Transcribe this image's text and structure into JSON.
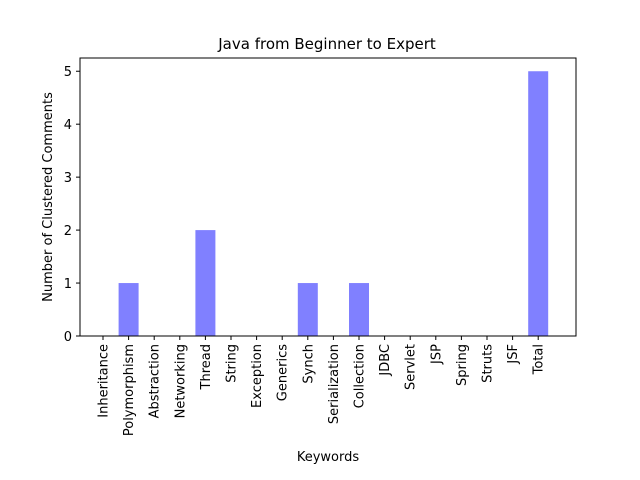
{
  "chart_data": {
    "type": "bar",
    "title": "Java from Beginner to Expert",
    "xlabel": "Keywords",
    "ylabel": "Number of Clustered Comments",
    "categories": [
      "Inheritance",
      "Polymorphism",
      "Abstraction",
      "Networking",
      "Thread",
      "String",
      "Exception",
      "Generics",
      "Synch",
      "Serialization",
      "Collection",
      "JDBC",
      "Servlet",
      "JSP",
      "Spring",
      "Struts",
      "JSF",
      "Total"
    ],
    "values": [
      0,
      1,
      0,
      0,
      2,
      0,
      0,
      0,
      1,
      0,
      1,
      0,
      0,
      0,
      0,
      0,
      0,
      5
    ],
    "yticks": [
      "0",
      "1",
      "2",
      "3",
      "4",
      "5"
    ],
    "ylim": [
      0,
      5.25
    ],
    "bar_color": "#8080ff",
    "grid": false,
    "legend": "none"
  }
}
